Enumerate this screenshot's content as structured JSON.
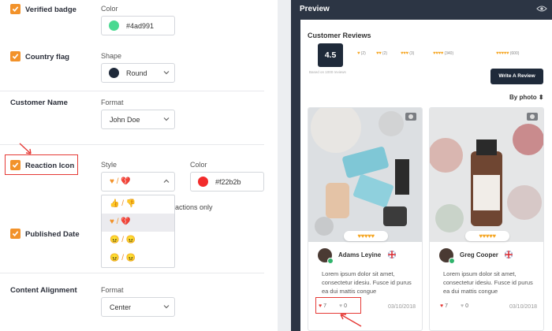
{
  "settings": {
    "verified_badge": {
      "label": "Verified badge",
      "checked": true,
      "color_label": "Color",
      "color_value": "#4ad991",
      "color_swatch": "#4ad991"
    },
    "country_flag": {
      "label": "Country flag",
      "checked": true,
      "shape_label": "Shape",
      "shape_value": "Round",
      "shape_swatch": "#1f2a3a"
    },
    "customer_name": {
      "label": "Customer Name",
      "format_label": "Format",
      "format_value": "John Doe"
    },
    "reaction_icon": {
      "label": "Reaction Icon",
      "checked": true,
      "style_label": "Style",
      "style_value": "♥ / 💔",
      "color_label": "Color",
      "color_value": "#f22b2b",
      "color_swatch": "#f22b2b",
      "behind_text": "actions only",
      "style_options": [
        "👍 / 👎",
        "♥ / 💔",
        "😠 / 😠",
        "😠 / 😠"
      ],
      "selected_option_index": 1
    },
    "published_date": {
      "label": "Published Date",
      "checked": true
    },
    "content_alignment": {
      "label": "Content Alignment",
      "format_label": "Format",
      "format_value": "Center"
    }
  },
  "preview": {
    "title": "Preview",
    "widget": {
      "heading": "Customer Reviews",
      "rating": "4.5",
      "based_on": "Based on 1000 reviews",
      "distribution": [
        {
          "hearts": "♥",
          "count": "(2)"
        },
        {
          "hearts": "♥♥",
          "count": "(2)"
        },
        {
          "hearts": "♥♥♥",
          "count": "(3)"
        },
        {
          "hearts": "♥♥♥♥",
          "count": "(340)"
        },
        {
          "hearts": "♥♥♥♥♥",
          "count": "(600)"
        }
      ],
      "write_review_label": "Write A Review",
      "sort_label": "By photo ⬍",
      "reviews": [
        {
          "hearts": "♥♥♥♥♥",
          "name": "Adams Leyine",
          "text": "Lorem ipsum dolor sit amet, consectetur idesiu. Fusce id purus ea dui mattis congue",
          "likes": "7",
          "dislikes": "0",
          "date": "03/10/2018"
        },
        {
          "hearts": "♥♥♥♥♥",
          "name": "Greg Cooper",
          "text": "Lorem ipsum dolor sit amet, consectetur idesiu. Fusce id purus ea dui mattis congue",
          "likes": "7",
          "dislikes": "0",
          "date": "03/10/2018"
        }
      ]
    }
  },
  "colors": {
    "accent_orange": "#f2922a",
    "highlight_red": "#e53935",
    "heart_gold": "#f5a623",
    "dark_navy": "#1f2a3a",
    "preview_frame": "#2c3544"
  }
}
